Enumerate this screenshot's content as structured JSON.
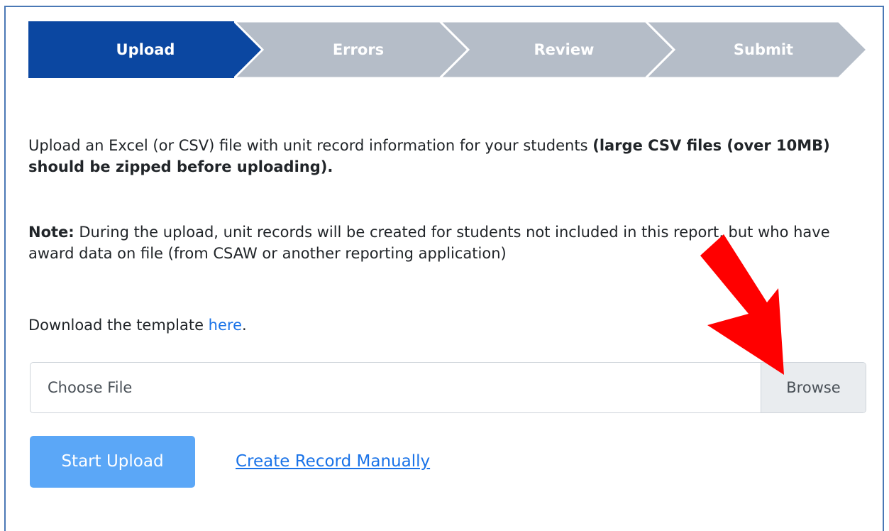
{
  "stepper": {
    "steps": [
      {
        "label": "Upload",
        "active": true
      },
      {
        "label": "Errors",
        "active": false
      },
      {
        "label": "Review",
        "active": false
      },
      {
        "label": "Submit",
        "active": false
      }
    ],
    "colors": {
      "active": "#0b47a1",
      "inactive": "#b5bdc8"
    }
  },
  "content": {
    "intro_text": "Upload an Excel (or CSV) file with unit record information for your students ",
    "intro_bold": "(large CSV files (over 10MB) should be zipped before uploading).",
    "note_label": "Note:",
    "note_text": " During the upload, unit records will be created for students not included in this report, but who have award data on file (from CSAW or another reporting application)",
    "download_prefix": "Download the template ",
    "download_link": "here",
    "download_suffix": "."
  },
  "file_input": {
    "placeholder": "Choose File",
    "browse_label": "Browse"
  },
  "actions": {
    "start_upload": "Start Upload",
    "create_manually": "Create Record Manually"
  },
  "annotation": {
    "arrow_color": "#ff0000"
  }
}
